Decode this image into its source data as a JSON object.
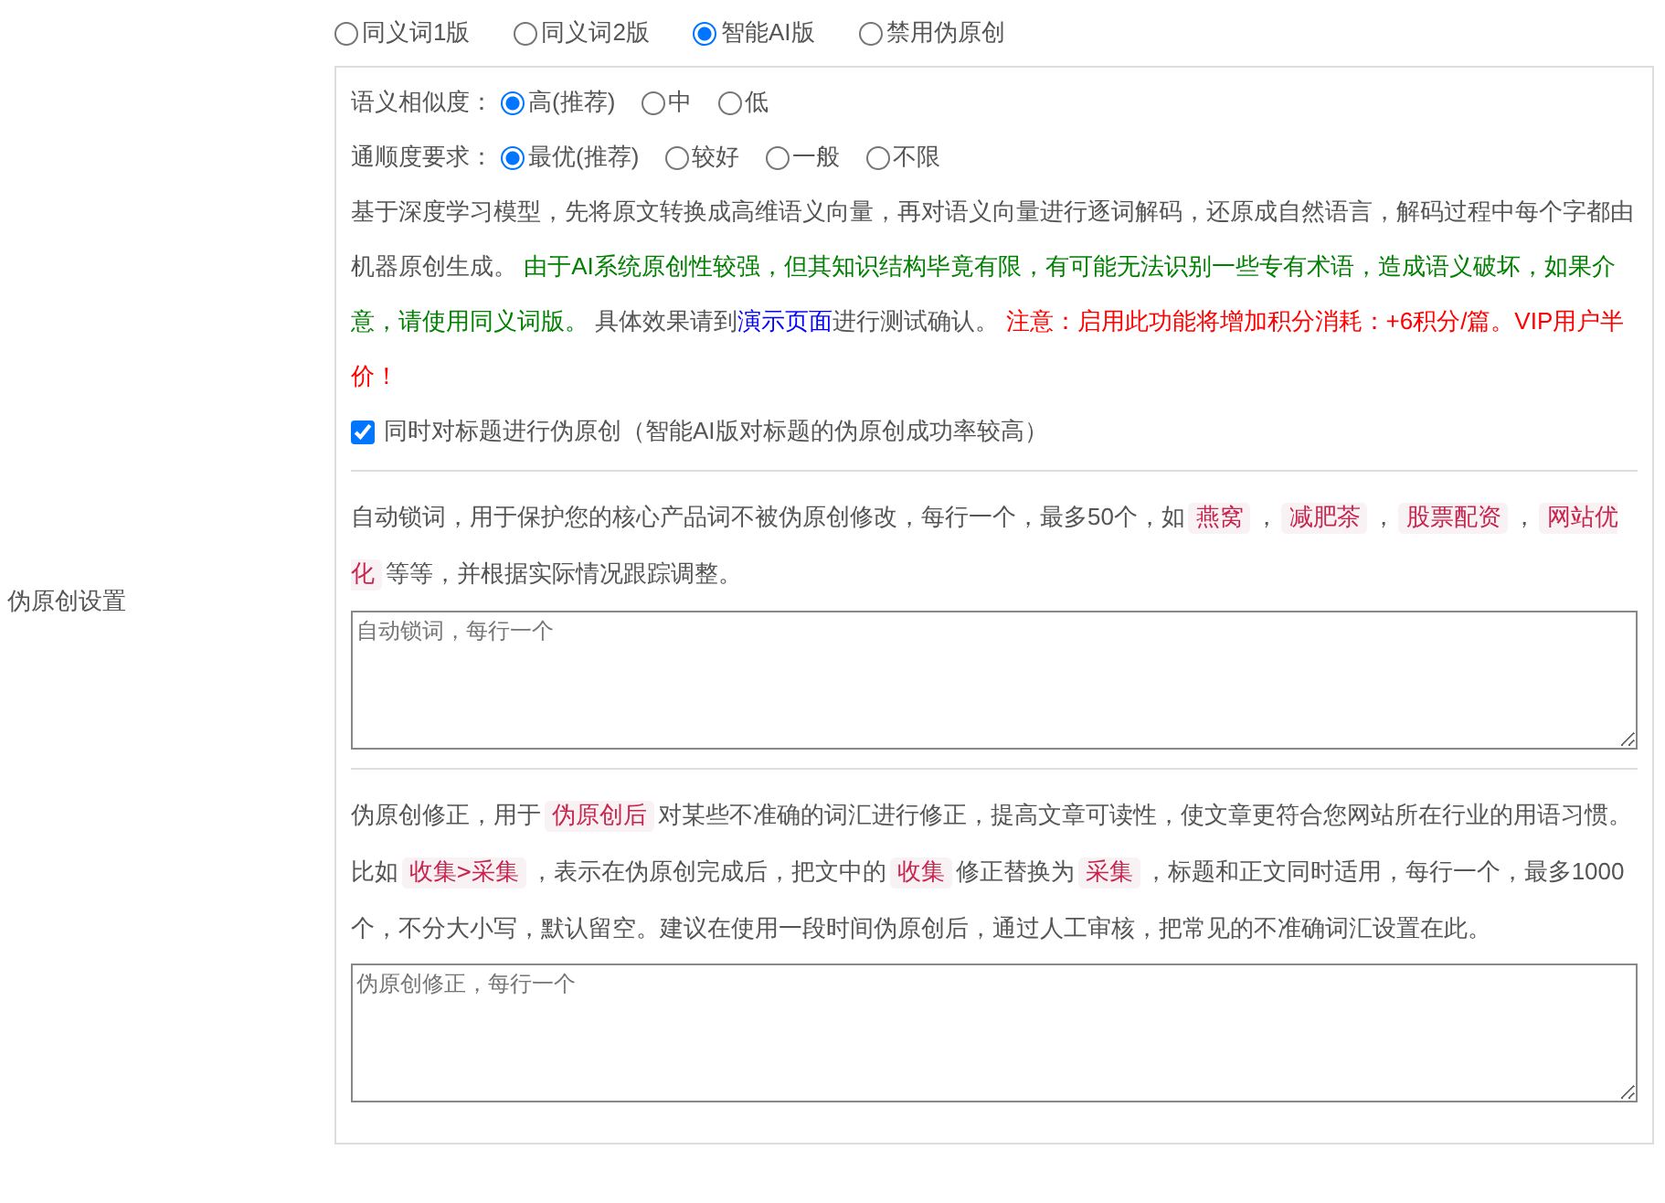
{
  "side_label": "伪原创设置",
  "modes": [
    {
      "label": "同义词1版",
      "selected": false
    },
    {
      "label": "同义词2版",
      "selected": false
    },
    {
      "label": "智能AI版",
      "selected": true
    },
    {
      "label": "禁用伪原创",
      "selected": false
    }
  ],
  "similarity": {
    "label": "语义相似度：",
    "options": [
      {
        "label": "高(推荐)",
        "selected": true
      },
      {
        "label": "中",
        "selected": false
      },
      {
        "label": "低",
        "selected": false
      }
    ]
  },
  "fluency": {
    "label": "通顺度要求：",
    "options": [
      {
        "label": "最优(推荐)",
        "selected": true
      },
      {
        "label": "较好",
        "selected": false
      },
      {
        "label": "一般",
        "selected": false
      },
      {
        "label": "不限",
        "selected": false
      }
    ]
  },
  "ai_description": [
    {
      "kind": "plain",
      "text": "基于深度学习模型，先将原文转换成高维语义向量，再对语义向量进行逐词解码，还原成自然语言，解码过程中每个字都由机器原创生成。 "
    },
    {
      "kind": "green",
      "text": "由于AI系统原创性较强，但其知识结构毕竟有限，有可能无法识别一些专有术语，造成语义破坏，如果介意，请使用同义词版。"
    },
    {
      "kind": "plain",
      "text": " 具体效果请到"
    },
    {
      "kind": "link",
      "text": "演示页面"
    },
    {
      "kind": "plain",
      "text": "进行测试确认。 "
    },
    {
      "kind": "red",
      "text": "注意：启用此功能将增加积分消耗：+6积分/篇。VIP用户半价！"
    }
  ],
  "title_option": {
    "label": "同时对标题进行伪原创（智能AI版对标题的伪原创成功率较高）",
    "checked": true
  },
  "lock_words": {
    "description": [
      {
        "kind": "plain",
        "text": "自动锁词，用于保护您的核心产品词不被伪原创修改，每行一个，最多50个，如"
      },
      {
        "kind": "tag",
        "text": "燕窝"
      },
      {
        "kind": "plain",
        "text": "，"
      },
      {
        "kind": "tag",
        "text": "减肥茶"
      },
      {
        "kind": "plain",
        "text": "，"
      },
      {
        "kind": "tag",
        "text": "股票配资"
      },
      {
        "kind": "plain",
        "text": "，"
      },
      {
        "kind": "tag",
        "text": "网站优化"
      },
      {
        "kind": "plain",
        "text": "等等，并根据实际情况跟踪调整。"
      }
    ],
    "placeholder": "自动锁词，每行一个"
  },
  "corrections": {
    "description": [
      {
        "kind": "plain",
        "text": "伪原创修正，用于"
      },
      {
        "kind": "tag",
        "text": "伪原创后"
      },
      {
        "kind": "plain",
        "text": "对某些不准确的词汇进行修正，提高文章可读性，使文章更符合您网站所在行业的用语习惯。比如"
      },
      {
        "kind": "tag",
        "text": "收集>采集"
      },
      {
        "kind": "plain",
        "text": "，表示在伪原创完成后，把文中的"
      },
      {
        "kind": "tag",
        "text": "收集"
      },
      {
        "kind": "plain",
        "text": "修正替换为"
      },
      {
        "kind": "tag",
        "text": "采集"
      },
      {
        "kind": "plain",
        "text": "，标题和正文同时适用，每行一个，最多1000个，不分大小写，默认留空。建议在使用一段时间伪原创后，通过人工审核，把常见的不准确词汇设置在此。"
      }
    ],
    "placeholder": "伪原创修正，每行一个"
  }
}
